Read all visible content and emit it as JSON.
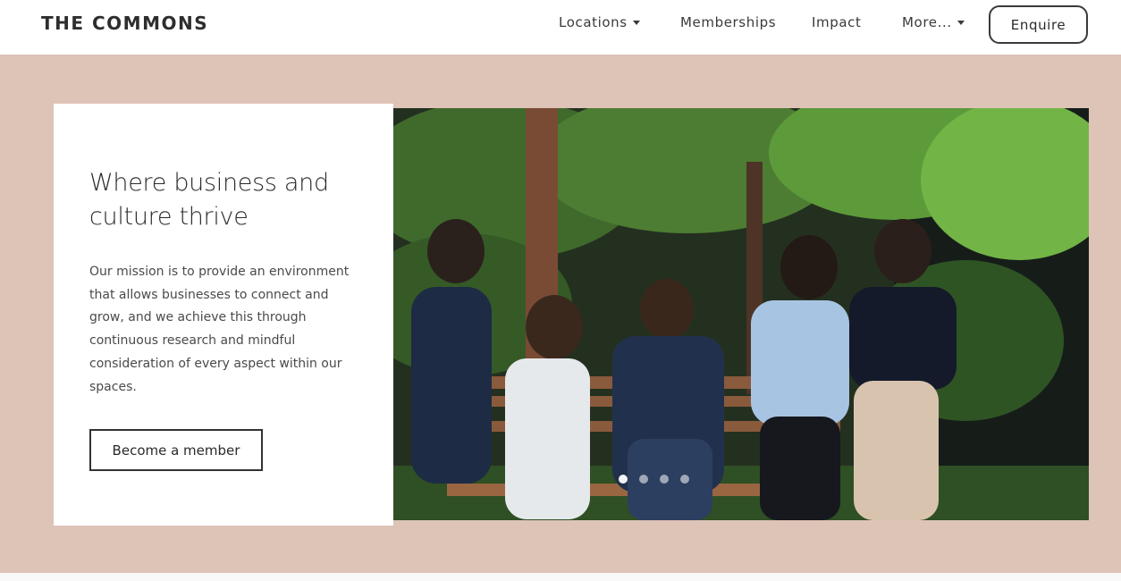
{
  "header": {
    "logo": "THE COMMONS",
    "nav": [
      {
        "label": "Locations",
        "dropdown": true
      },
      {
        "label": "Memberships",
        "dropdown": false
      },
      {
        "label": "Impact",
        "dropdown": false
      },
      {
        "label": "More...",
        "dropdown": true
      }
    ],
    "enquire_label": "Enquire"
  },
  "hero": {
    "background_color": "#dec3b7",
    "title": "Where business and culture thrive",
    "description": "Our mission is to provide an environment that allows businesses to connect and grow, and we achieve this through continuous research and mindful consideration of every aspect within our spaces.",
    "cta_label": "Become a member",
    "carousel": {
      "slide_count": 4,
      "active_index": 0
    }
  }
}
